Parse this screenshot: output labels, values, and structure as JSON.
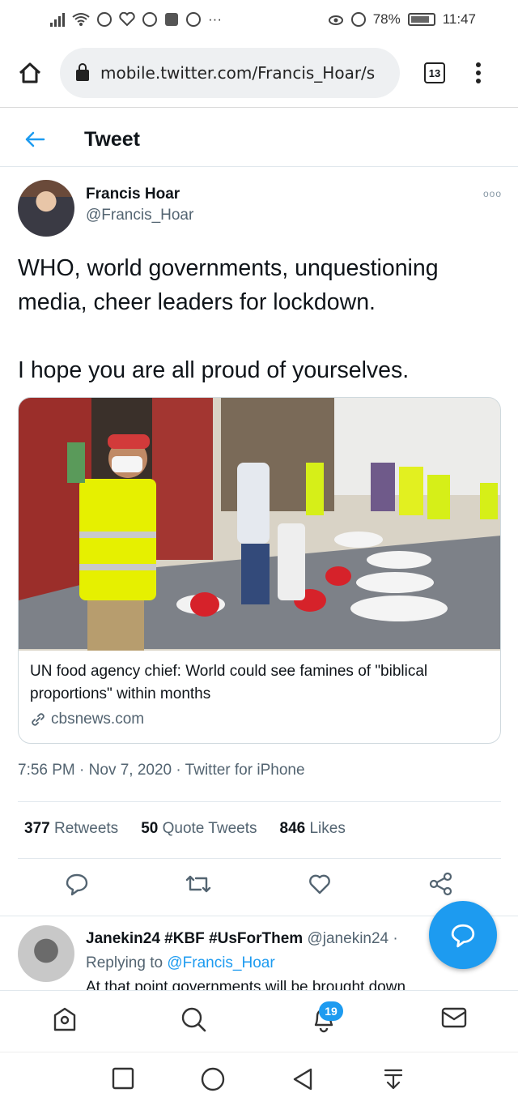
{
  "status_bar": {
    "battery": "78%",
    "time": "11:47",
    "icons": [
      "signal-icon",
      "wifi-icon",
      "messenger-icon",
      "heart-rate-icon",
      "alarm-icon",
      "news-icon",
      "pinterest-icon",
      "more-icon",
      "eye-icon",
      "clock-icon",
      "battery-icon"
    ]
  },
  "browser": {
    "url": "mobile.twitter.com/Francis_Hoar/s",
    "tab_count": "13",
    "icons": [
      "home-icon",
      "lock-icon",
      "overflow-menu-icon"
    ]
  },
  "header": {
    "title": "Tweet"
  },
  "tweet": {
    "author_name": "Francis Hoar",
    "author_handle": "@Francis_Hoar",
    "paragraphs": [
      "WHO, world governments, unquestioning media, cheer leaders for lockdown.",
      "I hope you are all proud of yourselves."
    ],
    "card": {
      "title": "UN food agency chief: World could see famines of \"biblical proportions\" within months",
      "domain": "cbsnews.com"
    },
    "time": "7:56 PM",
    "date": "Nov 7, 2020",
    "source": "Twitter for iPhone",
    "retweets_count": "377",
    "retweets_label": "Retweets",
    "quotes_count": "50",
    "quotes_label": "Quote Tweets",
    "likes_count": "846",
    "likes_label": "Likes"
  },
  "reply": {
    "name": "Janekin24 #KBF #UsForThem",
    "handle": "@janekin24 ·",
    "replying_prefix": "Replying to",
    "replying_to": "@Francis_Hoar",
    "text": "At that point governments will be brought down"
  },
  "bottom_nav": {
    "notifications_badge": "19"
  },
  "colors": {
    "accent": "#1d9bf0",
    "muted": "#536471",
    "text": "#0f1419"
  }
}
